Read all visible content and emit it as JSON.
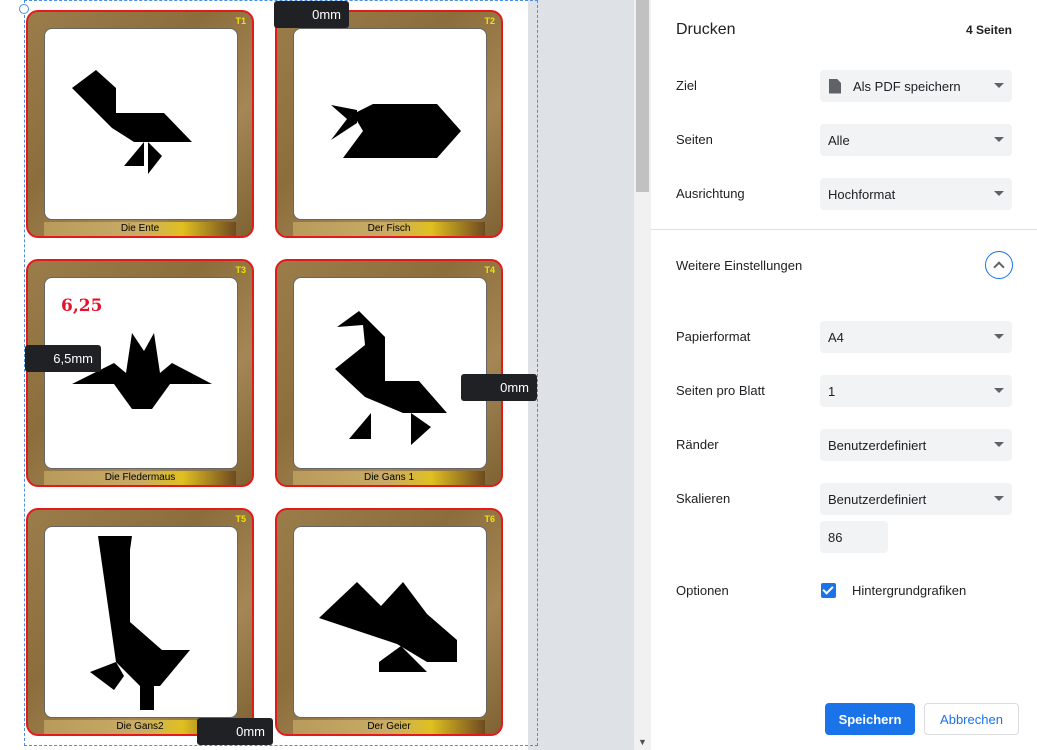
{
  "preview": {
    "cards": [
      {
        "num": "T1",
        "label": "Die Ente"
      },
      {
        "num": "T2",
        "label": "Der Fisch"
      },
      {
        "num": "T3",
        "label": "Die Fledermaus"
      },
      {
        "num": "T4",
        "label": "Die Gans 1"
      },
      {
        "num": "T5",
        "label": "Die Gans2"
      },
      {
        "num": "T6",
        "label": "Der Geier"
      }
    ],
    "margin_top": "0mm",
    "margin_left": "6,5mm",
    "margin_right": "0mm",
    "margin_bottom": "0mm",
    "annotation": "6,25"
  },
  "panel": {
    "title": "Drucken",
    "page_count": "4 Seiten",
    "destination": {
      "label": "Ziel",
      "value": "Als PDF speichern"
    },
    "pages": {
      "label": "Seiten",
      "value": "Alle"
    },
    "orientation": {
      "label": "Ausrichtung",
      "value": "Hochformat"
    },
    "more_settings": "Weitere Einstellungen",
    "paper": {
      "label": "Papierformat",
      "value": "A4"
    },
    "pages_per_sheet": {
      "label": "Seiten pro Blatt",
      "value": "1"
    },
    "margins": {
      "label": "Ränder",
      "value": "Benutzerdefiniert"
    },
    "scale": {
      "label": "Skalieren",
      "value": "Benutzerdefiniert",
      "custom": "86"
    },
    "options": {
      "label": "Optionen",
      "background_graphics": "Hintergrundgrafiken",
      "background_checked": true
    },
    "save_label": "Speichern",
    "cancel_label": "Abbrechen"
  },
  "colors": {
    "accent": "#1a73e8",
    "card_border": "#e51919",
    "card_num": "#f2e400"
  }
}
